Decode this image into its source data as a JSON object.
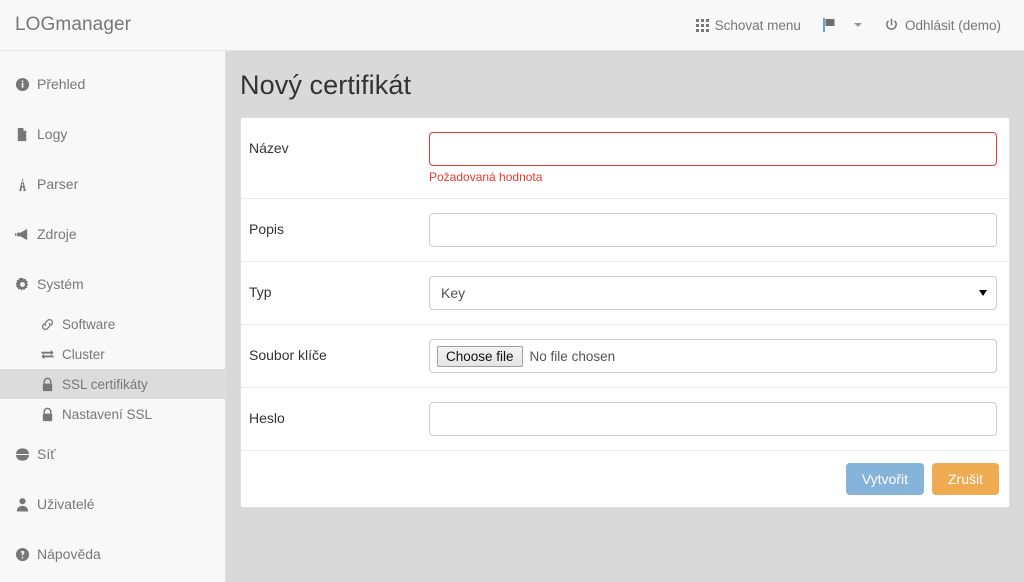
{
  "header": {
    "brand": "LOGmanager",
    "hide_menu": {
      "label": "Schovat menu",
      "icon": "grid-icon"
    },
    "language": {
      "icon": "flag-icon"
    },
    "logout": {
      "label": "Odhlásit (demo)",
      "icon": "power-icon"
    }
  },
  "sidebar": {
    "items": [
      {
        "label": "Přehled",
        "icon": "info-circle-icon",
        "level": 0,
        "active": false
      },
      {
        "label": "Logy",
        "icon": "file-icon",
        "level": 0,
        "active": false
      },
      {
        "label": "Parser",
        "icon": "road-icon",
        "level": 0,
        "active": false
      },
      {
        "label": "Zdroje",
        "icon": "megaphone-icon",
        "level": 0,
        "active": false
      },
      {
        "label": "Systém",
        "icon": "gear-icon",
        "level": 0,
        "active": false
      },
      {
        "label": "Software",
        "icon": "link-icon",
        "level": 1,
        "active": false
      },
      {
        "label": "Cluster",
        "icon": "exchange-icon",
        "level": 1,
        "active": false
      },
      {
        "label": "SSL certifikáty",
        "icon": "lock-icon",
        "level": 1,
        "active": true
      },
      {
        "label": "Nastavení SSL",
        "icon": "lock-icon",
        "level": 1,
        "active": false
      },
      {
        "label": "Síť",
        "icon": "globe-icon",
        "level": 0,
        "active": false
      },
      {
        "label": "Uživatelé",
        "icon": "user-icon",
        "level": 0,
        "active": false
      },
      {
        "label": "Nápověda",
        "icon": "question-circle-icon",
        "level": 0,
        "active": false
      }
    ]
  },
  "main": {
    "title": "Nový certifikát",
    "fields": {
      "name": {
        "label": "Název",
        "value": "",
        "placeholder": "",
        "error": "Požadovaná hodnota"
      },
      "desc": {
        "label": "Popis",
        "value": "",
        "placeholder": ""
      },
      "type": {
        "label": "Typ",
        "value": "Key",
        "options": [
          "Key"
        ]
      },
      "keyfile": {
        "label": "Soubor klíče",
        "button": "Choose file",
        "status": "No file chosen"
      },
      "password": {
        "label": "Heslo",
        "value": "",
        "placeholder": ""
      }
    },
    "buttons": {
      "submit": "Vytvořit",
      "cancel": "Zrušit"
    }
  },
  "colors": {
    "submit": "#85b3da",
    "cancel": "#eeab51",
    "error": "#e8392e",
    "page_bg": "#d9d9d9",
    "panel_bg": "#ffffff",
    "sidebar_bg": "#f8f8f8",
    "active_item_bg": "#dcdcdc",
    "text_muted": "#777777"
  }
}
